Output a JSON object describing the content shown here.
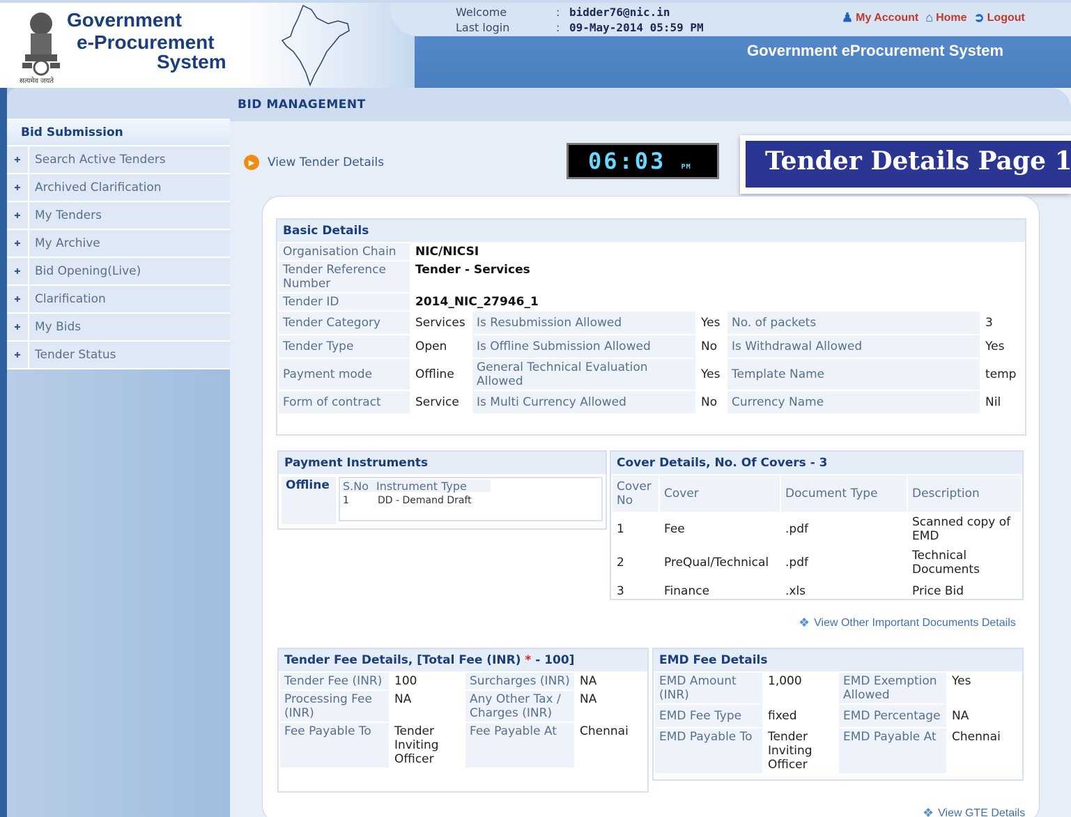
{
  "header": {
    "logo_line1": "Government",
    "logo_line2": "e-Procurement",
    "logo_line3": "System",
    "emblem_motto": "सत्यमेव जयते",
    "welcome_label": "Welcome",
    "welcome_value": "bidder76@nic.in",
    "lastlogin_label": "Last login",
    "lastlogin_value": "09-May-2014 05:59 PM",
    "colon": ":",
    "links": {
      "my_account": "My Account",
      "home": "Home",
      "logout": "Logout"
    },
    "site_title": "Government eProcurement System"
  },
  "sidebar": {
    "heading": "Bid Submission",
    "items": [
      {
        "label": "Search Active Tenders"
      },
      {
        "label": "Archived Clarification"
      },
      {
        "label": "My Tenders"
      },
      {
        "label": "My Archive"
      },
      {
        "label": "Bid Opening(Live)"
      },
      {
        "label": "Clarification"
      },
      {
        "label": "My Bids"
      },
      {
        "label": "Tender Status"
      }
    ]
  },
  "main": {
    "title": "BID MANAGEMENT",
    "view_tender_details": "View Tender Details",
    "clock": "06:03",
    "clock_ampm": "PM",
    "banner": "Tender Details Page 1"
  },
  "basic": {
    "heading": "Basic Details",
    "org_chain_k": "Organisation Chain",
    "org_chain_v": "NIC/NICSI",
    "ref_k": "Tender Reference Number",
    "ref_v": "Tender - Services",
    "id_k": "Tender ID",
    "id_v": "2014_NIC_27946_1",
    "rows": [
      {
        "k1": "Tender Category",
        "v1": "Services",
        "k2": "Is Resubmission Allowed",
        "v2": "Yes",
        "k3": "No. of packets",
        "v3": "3"
      },
      {
        "k1": "Tender Type",
        "v1": "Open",
        "k2": "Is Offline Submission Allowed",
        "v2": "No",
        "k3": "Is Withdrawal Allowed",
        "v3": "Yes"
      },
      {
        "k1": "Payment mode",
        "v1": "Offline",
        "k2": "General Technical Evaluation Allowed",
        "v2": "Yes",
        "k3": "Template Name",
        "v3": "temp"
      },
      {
        "k1": "Form of contract",
        "v1": "Service",
        "k2": "Is Multi Currency Allowed",
        "v2": "No",
        "k3": "Currency Name",
        "v3": "Nil"
      }
    ]
  },
  "payment": {
    "heading": "Payment Instruments",
    "mode": "Offline",
    "col_sno": "S.No",
    "col_type": "Instrument Type",
    "row_sno": "1",
    "row_type": "DD - Demand Draft"
  },
  "covers": {
    "heading": "Cover Details, No. Of Covers - 3",
    "cols": [
      "Cover No",
      "Cover",
      "Document Type",
      "Description"
    ],
    "rows": [
      {
        "no": "1",
        "cover": "Fee",
        "doc": ".pdf",
        "desc": "Scanned copy of EMD"
      },
      {
        "no": "2",
        "cover": "PreQual/Technical",
        "doc": ".pdf",
        "desc": "Technical Documents"
      },
      {
        "no": "3",
        "cover": "Finance",
        "doc": ".xls",
        "desc": "Price Bid"
      }
    ],
    "other_docs_link": "View Other Important Documents Details"
  },
  "tender_fee": {
    "heading_pre": "Tender Fee Details, [Total Fee (INR)",
    "heading_star": "*",
    "heading_post": " - 100]",
    "fee_k": "Tender Fee (INR)",
    "fee_v": "100",
    "sur_k": "Surcharges (INR)",
    "sur_v": "NA",
    "proc_k": "Processing Fee (INR)",
    "proc_v": "NA",
    "tax_k": "Any Other Tax / Charges (INR)",
    "tax_v": "NA",
    "payto_k": "Fee Payable To",
    "payto_v": "Tender Inviting Officer",
    "payat_k": "Fee Payable At",
    "payat_v": "Chennai"
  },
  "emd": {
    "heading": "EMD Fee Details",
    "amt_k": "EMD Amount (INR)",
    "amt_v": "1,000",
    "ex_k": "EMD Exemption Allowed",
    "ex_v": "Yes",
    "type_k": "EMD Fee Type",
    "type_v": "fixed",
    "pct_k": "EMD Percentage",
    "pct_v": "NA",
    "payto_k": "EMD Payable To",
    "payto_v": "Tender Inviting Officer",
    "payat_k": "EMD Payable At",
    "payat_v": "Chennai"
  },
  "gte_link": "View GTE Details"
}
